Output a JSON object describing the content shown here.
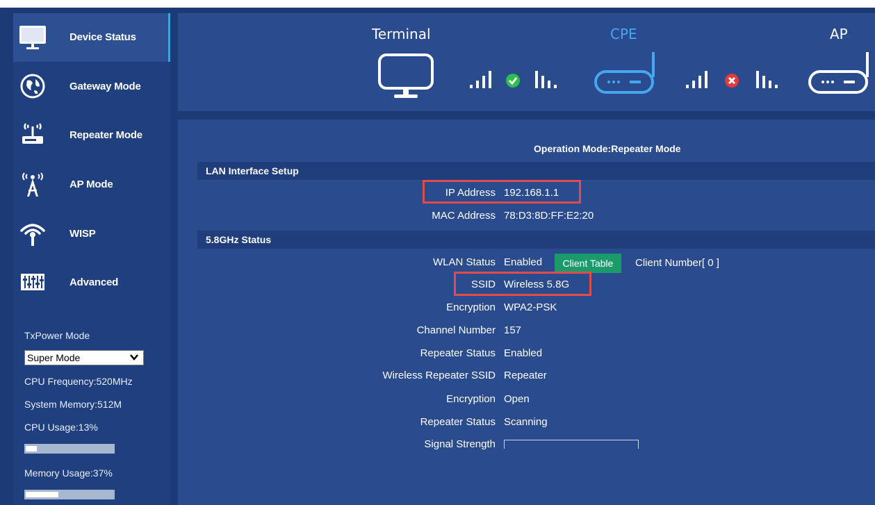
{
  "sidebar": {
    "items": [
      {
        "label": "Device Status",
        "icon": "monitor-icon",
        "active": true
      },
      {
        "label": "Gateway Mode",
        "icon": "globe-icon"
      },
      {
        "label": "Repeater Mode",
        "icon": "router-icon"
      },
      {
        "label": "AP Mode",
        "icon": "antenna-tower-icon"
      },
      {
        "label": "WISP",
        "icon": "wifi-signal-icon"
      },
      {
        "label": "Advanced",
        "icon": "equalizer-icon"
      }
    ],
    "txpower_label": "TxPower Mode",
    "txpower_value": "Super Mode",
    "cpu_frequency": "CPU Frequency:520MHz",
    "system_memory": "System Memory:512M",
    "cpu_usage": "CPU Usage:13%",
    "cpu_usage_fraction": 0.13,
    "memory_usage": "Memory Usage:37%",
    "memory_usage_fraction": 0.37
  },
  "header": {
    "terminal_label": "Terminal",
    "cpe_label": "CPE",
    "ap_label": "AP",
    "link1_status": "connected",
    "link2_status": "disconnected"
  },
  "main": {
    "operation_mode": "Operation Mode:Repeater Mode",
    "lan_section_title": "LAN Interface Setup",
    "ip_label": "IP Address",
    "ip_value": "192.168.1.1",
    "mac_label": "MAC Address",
    "mac_value": "78:D3:8D:FF:E2:20",
    "wifi_section_title": "5.8GHz Status",
    "wlan_status_label": "WLAN Status",
    "wlan_status_value": "Enabled",
    "client_table_label": "Client Table",
    "client_number": "Client Number[ 0 ]",
    "ssid_label": "SSID",
    "ssid_value": "Wireless 5.8G",
    "encryption_label": "Encryption",
    "encryption_value": "WPA2-PSK",
    "channel_label": "Channel Number",
    "channel_value": "157",
    "repeater_status_label": "Repeater Status",
    "repeater_status_value": "Enabled",
    "wireless_repeater_ssid_label": "Wireless Repeater SSID",
    "wireless_repeater_ssid_value": "Repeater",
    "encryption2_label": "Encryption",
    "encryption2_value": "Open",
    "repeater_status2_label": "Repeater Status",
    "repeater_status2_value": "Scanning",
    "signal_label": "Signal Strength"
  },
  "colors": {
    "background": "#1c3a76",
    "panel": "#2a4c8e",
    "accent": "#3fa0e8",
    "green_button": "#1b9a6b",
    "highlight_box": "#e24b4b"
  }
}
